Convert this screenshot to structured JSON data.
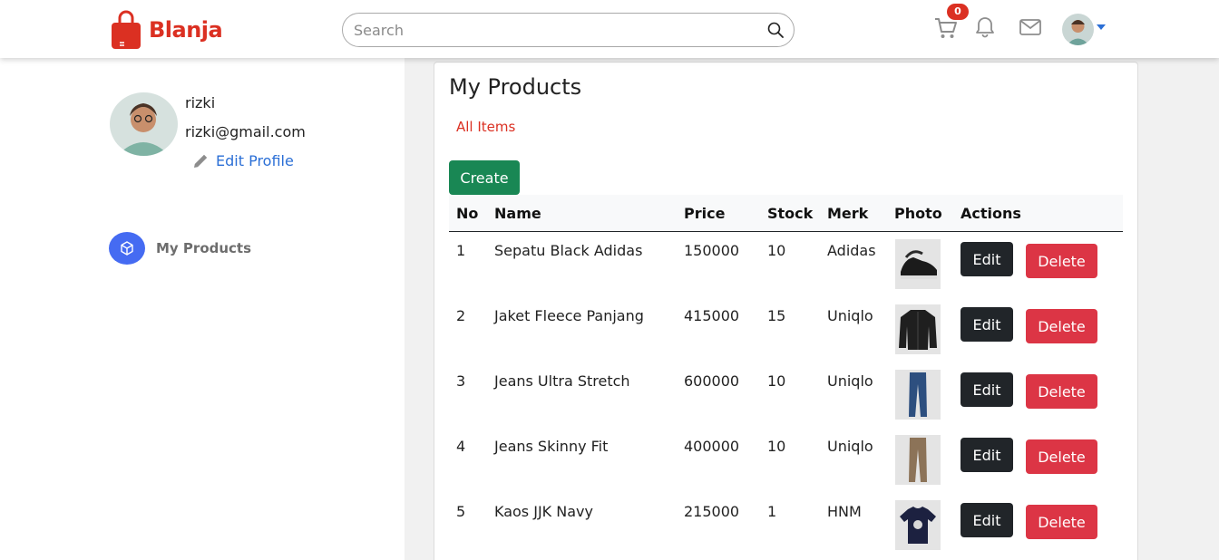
{
  "header": {
    "brand": "Blanja",
    "search_placeholder": "Search",
    "cart_count": "0",
    "icons": [
      "cart-icon",
      "bell-icon",
      "mail-icon",
      "avatar",
      "caret-down-icon"
    ],
    "brand_color": "#db3022"
  },
  "sidebar": {
    "user_name": "rizki",
    "user_email": "rizki@gmail.com",
    "edit_profile_label": "Edit Profile",
    "nav_items": [
      {
        "label": "My Products",
        "icon": "box-icon",
        "color": "#456bf2"
      }
    ]
  },
  "main": {
    "title": "My Products",
    "tab_all_items": "All Items",
    "create_label": "Create",
    "columns": [
      "No",
      "Name",
      "Price",
      "Stock",
      "Merk",
      "Photo",
      "Actions"
    ],
    "rows": [
      {
        "no": "1",
        "name": "Sepatu Black Adidas",
        "price": "150000",
        "stock": "10",
        "merk": "Adidas",
        "photo": "shoe-photo"
      },
      {
        "no": "2",
        "name": "Jaket Fleece Panjang",
        "price": "415000",
        "stock": "15",
        "merk": "Uniqlo",
        "photo": "jacket-photo"
      },
      {
        "no": "3",
        "name": "Jeans Ultra Stretch",
        "price": "600000",
        "stock": "10",
        "merk": "Uniqlo",
        "photo": "jeans-photo"
      },
      {
        "no": "4",
        "name": "Jeans Skinny Fit",
        "price": "400000",
        "stock": "10",
        "merk": "Uniqlo",
        "photo": "pants-photo"
      },
      {
        "no": "5",
        "name": "Kaos JJK Navy",
        "price": "215000",
        "stock": "1",
        "merk": "HNM",
        "photo": "tshirt-photo"
      }
    ],
    "edit_label": "Edit",
    "delete_label": "Delete",
    "colors": {
      "create": "#198754",
      "edit": "#212529",
      "delete": "#dc3545",
      "link": "#db3022"
    }
  }
}
